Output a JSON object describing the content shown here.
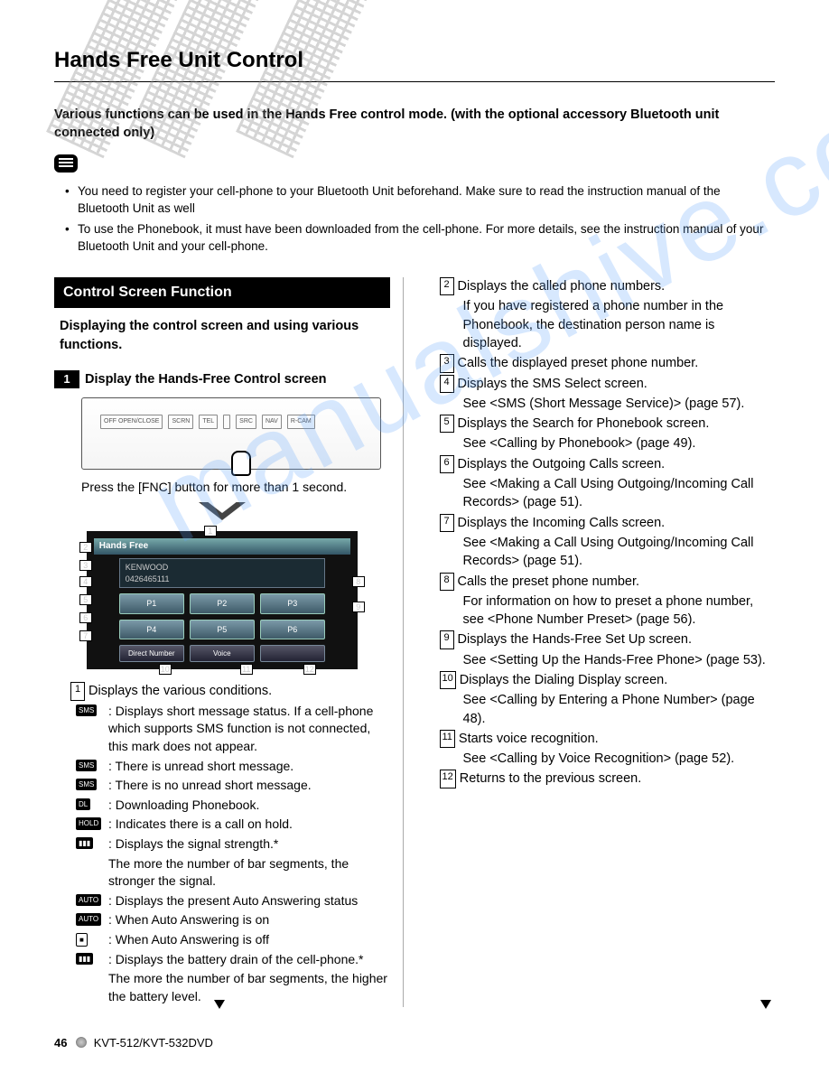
{
  "watermark": "manualshive.com",
  "header": {
    "title": "Hands Free Unit Control"
  },
  "intro": "Various functions can be used in the Hands Free control mode. (with the optional accessory Bluetooth unit connected only)",
  "notes": [
    "You need to register your cell-phone to your Bluetooth Unit beforehand. Make sure to read the instruction manual of the Bluetooth Unit as well",
    "To use the Phonebook, it must have been downloaded from the cell-phone. For more details, see the instruction manual of your Bluetooth Unit and your cell-phone."
  ],
  "section": {
    "title": "Control Screen Function",
    "intro": "Displaying the control screen and using various functions.",
    "step_num": "1",
    "step_title": "Display the Hands-Free Control screen",
    "panel_buttons": [
      "OFF\nOPEN/CLOSE",
      "SCRN",
      "TEL",
      "",
      "SRC",
      "NAV",
      "R-CAM"
    ],
    "caption": "Press the [FNC] button for more than 1 second.",
    "screen": {
      "title": "Hands Free",
      "name": "KENWOOD",
      "number": "0426465111",
      "presets": [
        "P1",
        "P2",
        "P3",
        "P4",
        "P5",
        "P6"
      ],
      "bottom": [
        "Direct Number",
        "Voice",
        ""
      ]
    }
  },
  "item1": {
    "num": "1",
    "lead": "Displays the various conditions.",
    "subs": [
      {
        "tag": "SMS",
        "text": ": Displays short message status. If a cell-phone which supports SMS function is not connected, this mark does not appear."
      },
      {
        "tag": "SMS",
        "text": ": There is unread short message."
      },
      {
        "tag": "SMS",
        "text": ": There is no unread short message."
      },
      {
        "tag": "DL",
        "text": ": Downloading Phonebook."
      },
      {
        "tag": "HOLD",
        "text": ": Indicates there is a call on hold."
      },
      {
        "tag": "▮▮▮",
        "text": ": Displays the signal strength.*"
      },
      {
        "tag": "",
        "text": "The more the number of bar segments, the stronger the signal.",
        "plain": true
      },
      {
        "tag": "AUTO",
        "text": ": Displays the present Auto Answering status"
      },
      {
        "tag": "AUTO",
        "text": ": When Auto Answering is on"
      },
      {
        "tag": "■",
        "text": ": When Auto Answering is off",
        "outline": true
      },
      {
        "tag": "▮▮▮",
        "text": ": Displays the battery drain of the cell-phone.*"
      },
      {
        "tag": "",
        "text": "The more the number of bar segments, the higher the battery level.",
        "plain": true
      }
    ]
  },
  "right": [
    {
      "num": "2",
      "lines": [
        "Displays the called phone numbers.",
        "If you have registered a phone number in the Phonebook, the destination person name is displayed."
      ]
    },
    {
      "num": "3",
      "lines": [
        "Calls the displayed preset phone number."
      ]
    },
    {
      "num": "4",
      "lines": [
        "Displays the SMS Select screen.",
        "See <SMS (Short Message Service)> (page 57)."
      ]
    },
    {
      "num": "5",
      "lines": [
        "Displays the Search for Phonebook screen.",
        "See <Calling by Phonebook> (page 49)."
      ]
    },
    {
      "num": "6",
      "lines": [
        "Displays the Outgoing Calls screen.",
        "See <Making a Call Using Outgoing/Incoming Call Records> (page 51)."
      ]
    },
    {
      "num": "7",
      "lines": [
        "Displays the Incoming Calls screen.",
        "See <Making a Call Using Outgoing/Incoming Call Records> (page 51)."
      ]
    },
    {
      "num": "8",
      "lines": [
        "Calls the preset phone number.",
        "For information on how to preset a phone number, see <Phone Number Preset> (page 56)."
      ]
    },
    {
      "num": "9",
      "lines": [
        "Displays the Hands-Free Set Up screen.",
        "See <Setting Up the Hands-Free Phone> (page 53)."
      ]
    },
    {
      "num": "10",
      "lines": [
        "Displays the Dialing Display screen.",
        "See <Calling by Entering a Phone Number> (page 48)."
      ]
    },
    {
      "num": "11",
      "lines": [
        "Starts voice recognition.",
        "See <Calling by Voice Recognition> (page 52)."
      ]
    },
    {
      "num": "12",
      "lines": [
        "Returns to the previous screen."
      ]
    }
  ],
  "footer": {
    "page": "46",
    "model": "KVT-512/KVT-532DVD"
  }
}
